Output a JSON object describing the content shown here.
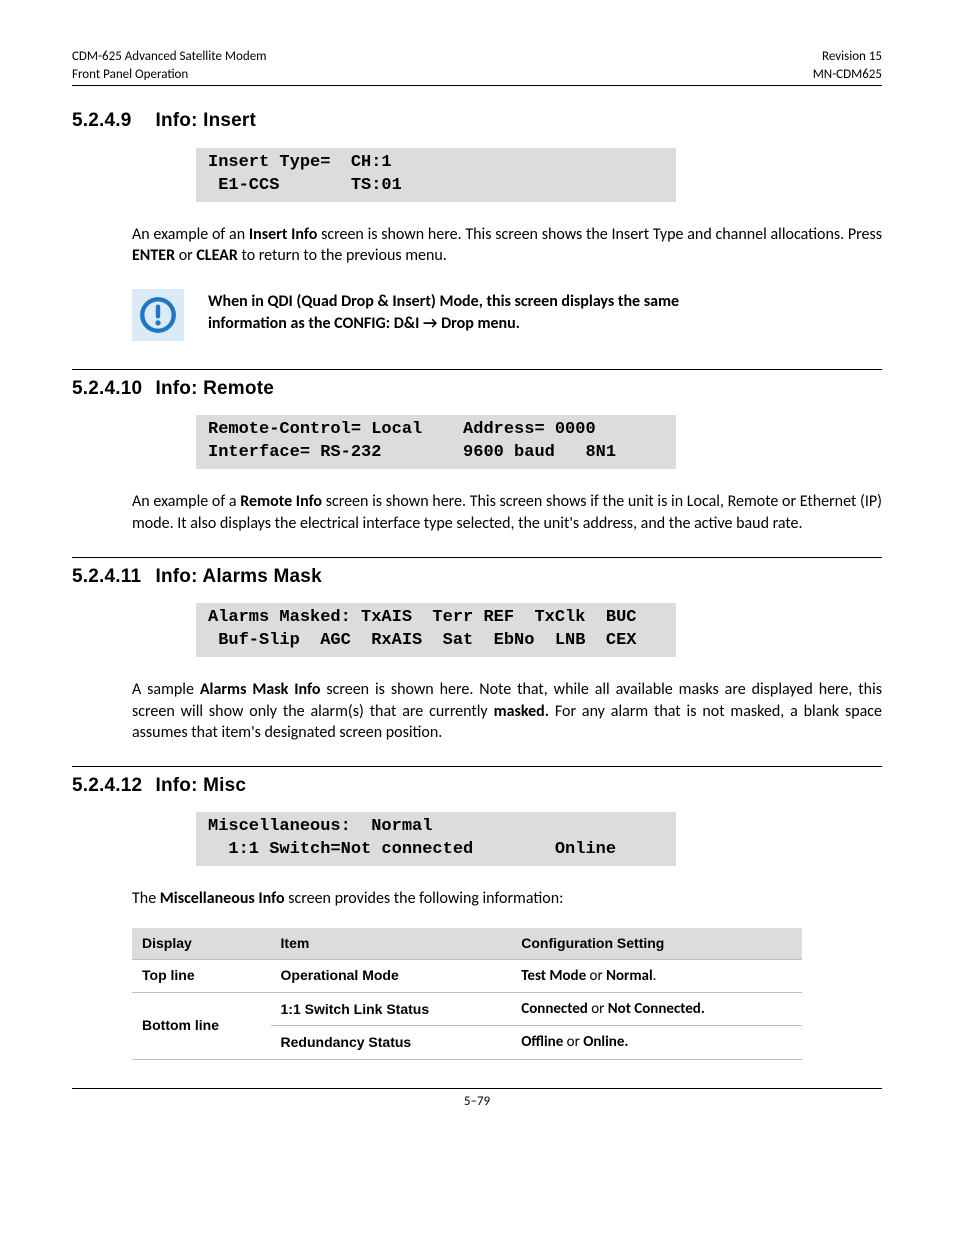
{
  "header": {
    "left1": "CDM-625 Advanced Satellite Modem",
    "left2": "Front Panel Operation",
    "right1": "Revision 15",
    "right2": "MN-CDM625"
  },
  "sections": {
    "s1": {
      "num": "5.2.4.9",
      "title": "Info: Insert"
    },
    "s2": {
      "num": "5.2.4.10",
      "title": "Info: Remote"
    },
    "s3": {
      "num": "5.2.4.11",
      "title": "Info: Alarms Mask"
    },
    "s4": {
      "num": "5.2.4.12",
      "title": "Info: Misc"
    }
  },
  "screens": {
    "insert": "Insert Type=  CH:1\n E1-CCS       TS:01",
    "remote": "Remote-Control= Local    Address= 0000\nInterface= RS-232        9600 baud   8N1",
    "alarms": "Alarms Masked: TxAIS  Terr REF  TxClk  BUC\n Buf-Slip  AGC  RxAIS  Sat  EbNo  LNB  CEX",
    "misc": "Miscellaneous:  Normal\n  1:1 Switch=Not connected        Online"
  },
  "para": {
    "insert_pre": "An example of an ",
    "insert_b1": "Insert Info",
    "insert_mid": " screen is shown here. This screen shows the Insert Type and channel allocations. Press ",
    "insert_b2": "ENTER",
    "insert_or": " or ",
    "insert_b3": "CLEAR",
    "insert_post": " to return to the previous menu.",
    "note_l1": "When in QDI (Quad Drop & Insert) Mode, this screen displays the same",
    "note_l2a": "information as the CONFIG: D&I ",
    "note_arrow": "→",
    "note_l2b": " Drop menu.",
    "remote_pre": "An example of a ",
    "remote_b1": "Remote Info",
    "remote_post": " screen is shown here. This screen shows if the unit is in Local, Remote or Ethernet (IP) mode. It also displays the electrical interface type selected, the unit's address, and the active baud rate.",
    "alarms_pre": "A sample ",
    "alarms_b1": "Alarms Mask Info",
    "alarms_mid": " screen is shown here. Note that, while all available masks are displayed here, this screen will show only the alarm(s) that are currently ",
    "alarms_b2": "masked.",
    "alarms_post": " For any alarm that is not masked, a blank space assumes that item's designated screen position.",
    "misc_pre": "The ",
    "misc_b1": "Miscellaneous Info",
    "misc_post": " screen provides the following information:"
  },
  "table": {
    "h1": "Display",
    "h2": "Item",
    "h3": "Configuration Setting",
    "r1c1": "Top line",
    "r1c2": "Operational Mode",
    "r1c3a": "Test Mode",
    "r1c3or": " or ",
    "r1c3b": "Normal",
    "r1c3dot": ".",
    "r23c1": "Bottom line",
    "r2c2": "1:1 Switch Link Status",
    "r2c3a": "Connected",
    "r2c3or": " or ",
    "r2c3b": "Not Connected.",
    "r3c2": "Redundancy Status",
    "r3c3a": "Offline",
    "r3c3or": " or ",
    "r3c3b": "Online."
  },
  "footer": {
    "page": "5–79"
  }
}
